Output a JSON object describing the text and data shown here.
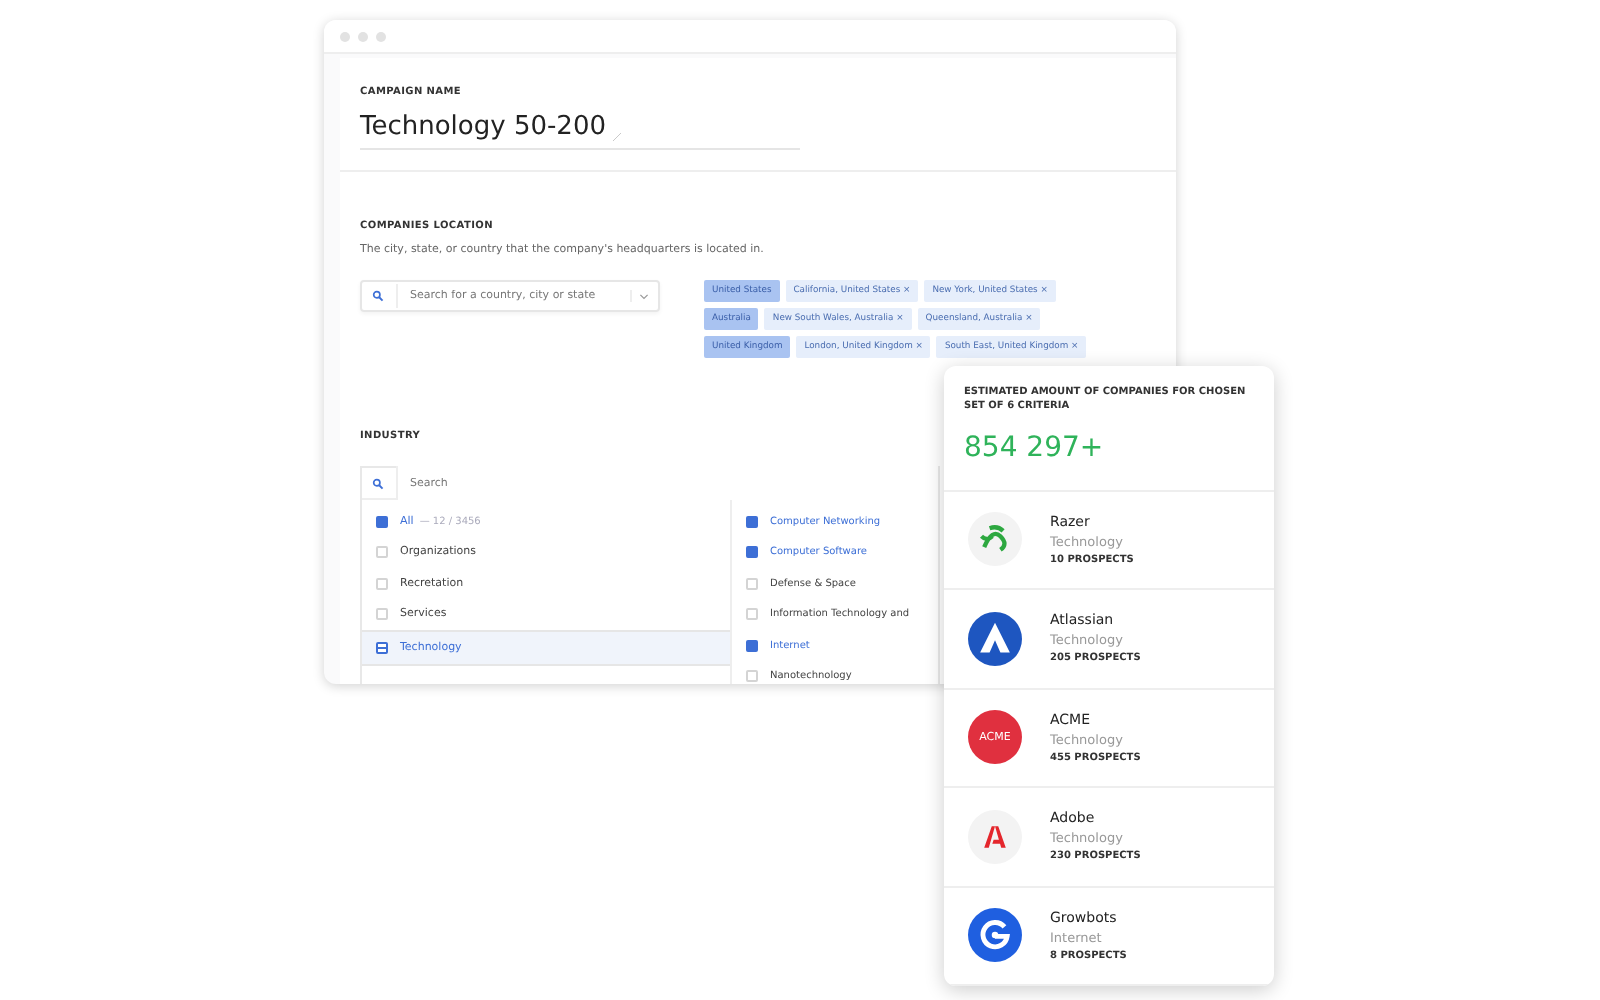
{
  "window": {
    "campaign_name": {
      "label": "CAMPAIGN NAME",
      "value": "Technology 50-200"
    },
    "location": {
      "label": "COMPANIES LOCATION",
      "description": "The city, state, or country that the company's headquarters is located in.",
      "search": {
        "placeholder": "Search for a country, city or state"
      },
      "chips": [
        {
          "label": "United States",
          "selected": true
        },
        {
          "label": "California, United States ×",
          "selected": false
        },
        {
          "label": "New York, United States ×",
          "selected": false
        },
        {
          "label": "Australia",
          "selected": true
        },
        {
          "label": "New South Wales, Australia ×",
          "selected": false
        },
        {
          "label": "Queensland, Australia ×",
          "selected": false
        },
        {
          "label": "United Kingdom",
          "selected": true
        },
        {
          "label": "London, United Kingdom ×",
          "selected": false
        },
        {
          "label": "South East, United Kingdom ×",
          "selected": false
        }
      ]
    },
    "industry": {
      "label": "INDUSTRY",
      "search": {
        "placeholder": "Search"
      },
      "all": {
        "label": "All",
        "count": "— 12 / 3456",
        "checked": true
      },
      "categories": [
        {
          "label": "Organizations",
          "checked": false,
          "indeterminate": false,
          "selected": false
        },
        {
          "label": "Recretation",
          "checked": false,
          "indeterminate": false,
          "selected": false
        },
        {
          "label": "Services",
          "checked": false,
          "indeterminate": false,
          "selected": false
        },
        {
          "label": "Technology",
          "checked": false,
          "indeterminate": true,
          "selected": true
        }
      ],
      "subcategories": [
        {
          "label": "Computer Networking",
          "checked": true
        },
        {
          "label": "Computer Software",
          "checked": true
        },
        {
          "label": "Defense & Space",
          "checked": false
        },
        {
          "label": "Information Technology and",
          "checked": false
        },
        {
          "label": "Internet",
          "checked": true
        },
        {
          "label": "Nanotechnology",
          "checked": false
        }
      ]
    }
  },
  "estimate": {
    "title": "ESTIMATED AMOUNT OF COMPANIES FOR CHOSEN SET OF 6 CRITERIA",
    "amount": "854 297+",
    "companies": [
      {
        "name": "Razer",
        "industry": "Technology",
        "prospects": "10 PROSPECTS",
        "kind": "snake"
      },
      {
        "name": "Atlassian",
        "industry": "Technology",
        "prospects": "205 PROSPECTS",
        "kind": "peak"
      },
      {
        "name": "ACME",
        "industry": "Technology",
        "prospects": "455 PROSPECTS",
        "kind": "wordmark",
        "logo_text": "ACME"
      },
      {
        "name": "Adobe",
        "industry": "Technology",
        "prospects": "230 PROSPECTS",
        "kind": "letter-a"
      },
      {
        "name": "Growbots",
        "industry": "Internet",
        "prospects": "8 PROSPECTS",
        "kind": "spiral"
      }
    ]
  }
}
